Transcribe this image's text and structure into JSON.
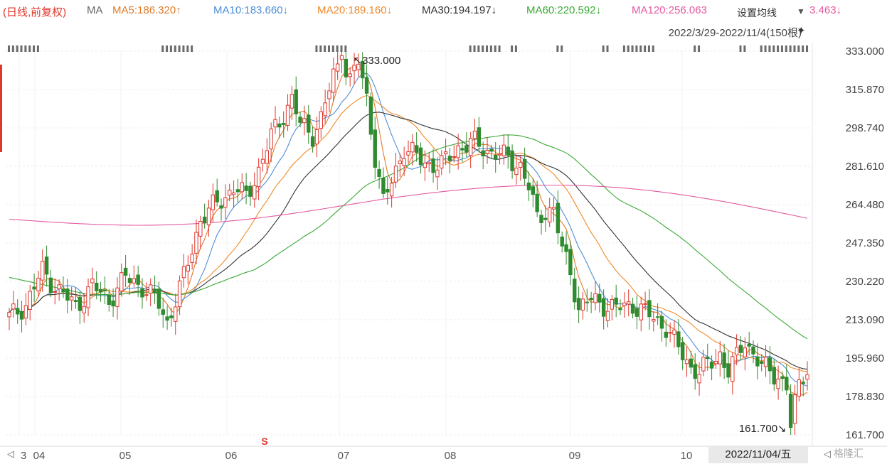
{
  "ma_bar": {
    "prefix": "(日线,前复权)",
    "label": "MA",
    "items": [
      {
        "text": "MA5:186.320↑",
        "color": "#e07b2a"
      },
      {
        "text": "MA10:183.660↓",
        "color": "#4f8fd6"
      },
      {
        "text": "MA20:189.160↓",
        "color": "#f08a2a"
      },
      {
        "text": "MA30:194.197↓",
        "color": "#333333"
      },
      {
        "text": "MA60:220.592↓",
        "color": "#3aaa35"
      },
      {
        "text": "MA120:256.063",
        "color": "#e45aa0"
      }
    ],
    "settings_label": "设置均线",
    "overflow_text": "3.463↓"
  },
  "range_label": "2022/3/29-2022/11/4(150根)",
  "date_badge": "2022/11/04/五",
  "nav_prev": "◁",
  "nav_back": "◁",
  "watermark": "格隆汇",
  "signal_mark": "S",
  "chart_data": {
    "type": "candlestick",
    "title": "",
    "period": "daily, forward-adjusted",
    "date_range": [
      "2022-03-29",
      "2022-11-04"
    ],
    "bar_count": 150,
    "ylim": [
      161.7,
      333.0
    ],
    "y_ticks": [
      "333.000",
      "315.870",
      "298.740",
      "281.610",
      "264.480",
      "247.350",
      "230.220",
      "213.090",
      "195.960",
      "178.830",
      "161.700"
    ],
    "x_ticks": [
      "3",
      "04",
      "05",
      "06",
      "07",
      "08",
      "09",
      "10"
    ],
    "annotations": [
      {
        "text": "333.000",
        "type": "high",
        "value": 333.0
      },
      {
        "text": "161.700",
        "type": "low",
        "value": 161.7
      }
    ],
    "colors": {
      "up": "#e0362c",
      "down": "#2e8b2e"
    },
    "ma_lines": [
      {
        "name": "MA5",
        "last": 186.32,
        "color": "#e07b2a"
      },
      {
        "name": "MA10",
        "last": 183.66,
        "color": "#4f8fd6"
      },
      {
        "name": "MA20",
        "last": 189.16,
        "color": "#f08a2a"
      },
      {
        "name": "MA30",
        "last": 194.197,
        "color": "#333333"
      },
      {
        "name": "MA60",
        "last": 220.592,
        "color": "#3aaa35"
      },
      {
        "name": "MA120",
        "last": 256.063,
        "color": "#e45aa0"
      }
    ],
    "price_path": [
      [
        0,
        214
      ],
      [
        4,
        220
      ],
      [
        8,
        235
      ],
      [
        12,
        226
      ],
      [
        16,
        219
      ],
      [
        20,
        228
      ],
      [
        24,
        222
      ],
      [
        28,
        232
      ],
      [
        32,
        228
      ],
      [
        36,
        220
      ],
      [
        38,
        212
      ],
      [
        42,
        232
      ],
      [
        46,
        258
      ],
      [
        50,
        265
      ],
      [
        54,
        272
      ],
      [
        57,
        268
      ],
      [
        60,
        280
      ],
      [
        63,
        295
      ],
      [
        66,
        305
      ],
      [
        68,
        312
      ],
      [
        70,
        300
      ],
      [
        73,
        296
      ],
      [
        75,
        303
      ],
      [
        78,
        322
      ],
      [
        80,
        330
      ],
      [
        82,
        320
      ],
      [
        84,
        328
      ],
      [
        86,
        312
      ],
      [
        88,
        286
      ],
      [
        90,
        265
      ],
      [
        92,
        275
      ],
      [
        95,
        290
      ],
      [
        100,
        283
      ],
      [
        104,
        282
      ],
      [
        108,
        290
      ],
      [
        112,
        292
      ],
      [
        116,
        288
      ],
      [
        120,
        285
      ],
      [
        123,
        282
      ],
      [
        125,
        272
      ],
      [
        127,
        258
      ],
      [
        129,
        262
      ],
      [
        131,
        262
      ],
      [
        133,
        244
      ],
      [
        135,
        235
      ],
      [
        137,
        218
      ],
      [
        140,
        222
      ],
      [
        143,
        220
      ],
      [
        146,
        218
      ],
      [
        150,
        220
      ],
      [
        154,
        215
      ],
      [
        158,
        210
      ],
      [
        161,
        200
      ],
      [
        164,
        192
      ],
      [
        166,
        190
      ],
      [
        169,
        194
      ],
      [
        171,
        198
      ],
      [
        173,
        190
      ],
      [
        175,
        196
      ],
      [
        177,
        204
      ],
      [
        179,
        198
      ],
      [
        181,
        192
      ],
      [
        183,
        190
      ],
      [
        185,
        188
      ],
      [
        187,
        183
      ],
      [
        188,
        166
      ],
      [
        189,
        175
      ],
      [
        190,
        184
      ],
      [
        191,
        189
      ],
      [
        192,
        192
      ]
    ]
  }
}
